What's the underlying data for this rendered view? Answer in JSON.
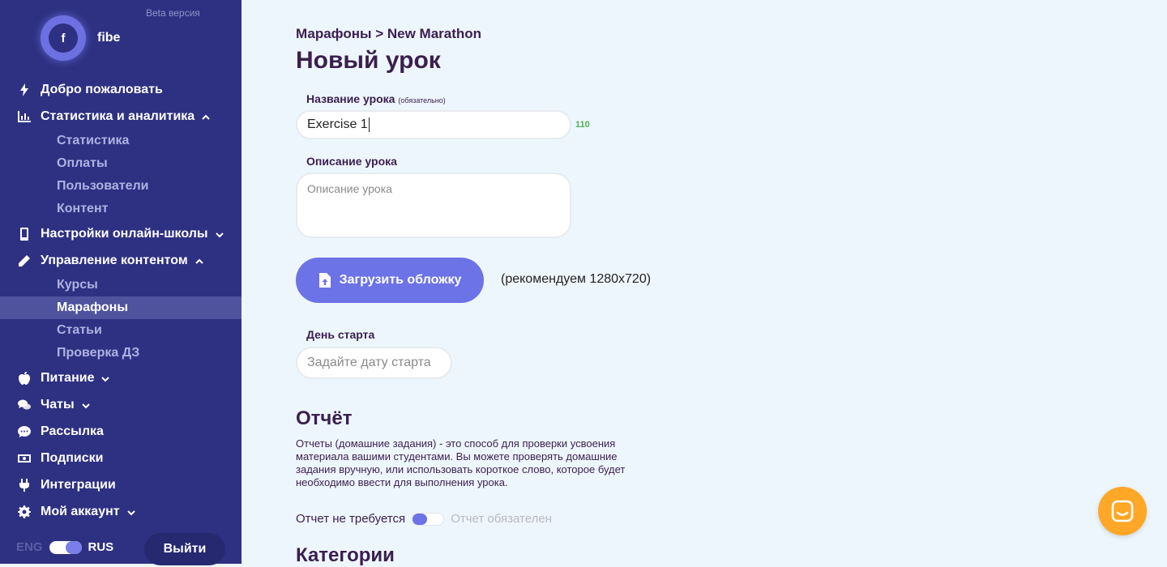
{
  "sidebar": {
    "beta_label": "Beta версия",
    "avatar_letter": "f",
    "username": "fibe",
    "nav": {
      "welcome": "Добро пожаловать",
      "stats": "Статистика и аналитика",
      "stats_sub": [
        "Статистика",
        "Оплаты",
        "Пользователи",
        "Контент"
      ],
      "school_settings": "Настройки онлайн-школы",
      "content_mgmt": "Управление контентом",
      "content_sub": [
        "Курсы",
        "Марафоны",
        "Статьи",
        "Проверка ДЗ"
      ],
      "nutrition": "Питание",
      "chats": "Чаты",
      "mailing": "Рассылка",
      "subscriptions": "Подписки",
      "integrations": "Интеграции",
      "account": "Мой аккаунт"
    },
    "lang_eng": "ENG",
    "lang_rus": "RUS",
    "logout": "Выйти"
  },
  "main": {
    "breadcrumb": "Марафоны > New Marathon",
    "title": "Новый урок",
    "name_label": "Название урока",
    "name_required": "(обязательно)",
    "name_value": "Exercise 1",
    "name_counter": "110",
    "desc_label": "Описание урока",
    "desc_placeholder": "Описание урока",
    "upload_button": "Загрузить обложку",
    "upload_hint": "(рекомендуем 1280x720)",
    "start_label": "День старта",
    "start_placeholder": "Задайте дату старта",
    "report_title": "Отчёт",
    "report_desc": "Отчеты (домашние задания) - это способ для проверки усвоения материала вашими студентами. Вы можете проверять домашние задания вручную, или использовать короткое слово, которое будет необходимо ввести для выполнения урока.",
    "report_off": "Отчет не требуется",
    "report_on": "Отчет обязателен",
    "categories_title": "Категории"
  },
  "colors": {
    "sidebar_bg": "#2e3182",
    "accent": "#6c73e6",
    "page_bg": "#eef6fd",
    "chat_fab": "#ffa726"
  }
}
